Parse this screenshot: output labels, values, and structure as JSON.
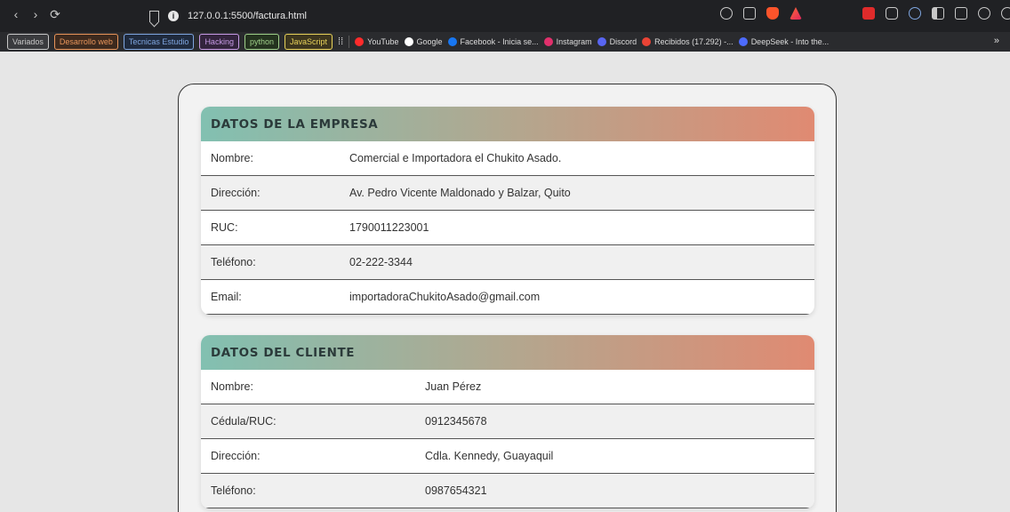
{
  "browser": {
    "url": "127.0.0.1:5500/factura.html",
    "bookmark_chips": [
      {
        "label": "Variados",
        "color": "#c8c8c8",
        "bg": "#3a3b3e"
      },
      {
        "label": "Desarrollo web",
        "color": "#e8955a",
        "bg": "#3d2a1e"
      },
      {
        "label": "Tecnicas Estudio",
        "color": "#7fa6e0",
        "bg": "#1f2a3d"
      },
      {
        "label": "Hacking",
        "color": "#c79be6",
        "bg": "#33243d"
      },
      {
        "label": "python",
        "color": "#9fd08a",
        "bg": "#24331f"
      },
      {
        "label": "JavaScript",
        "color": "#e8d25a",
        "bg": "#3d361e"
      }
    ],
    "bookmarks": [
      {
        "label": "YouTube",
        "icon": "youtube-icon",
        "color": "#ff2b2b"
      },
      {
        "label": "Google",
        "icon": "google-icon",
        "color": "#ffffff"
      },
      {
        "label": "Facebook - Inicia se...",
        "icon": "facebook-icon",
        "color": "#1877f2"
      },
      {
        "label": "Instagram",
        "icon": "instagram-icon",
        "color": "#e1306c"
      },
      {
        "label": "Discord",
        "icon": "discord-icon",
        "color": "#5865f2"
      },
      {
        "label": "Recibidos (17.292) -...",
        "icon": "gmail-icon",
        "color": "#ea4335"
      },
      {
        "label": "DeepSeek - Into the...",
        "icon": "deepseek-icon",
        "color": "#4d6bfe"
      }
    ],
    "more": "»"
  },
  "empresa": {
    "title": "DATOS DE LA EMPRESA",
    "rows": [
      {
        "label": "Nombre:",
        "value": "Comercial e Importadora el Chukito Asado."
      },
      {
        "label": "Dirección:",
        "value": "Av. Pedro Vicente Maldonado y Balzar, Quito"
      },
      {
        "label": "RUC:",
        "value": "1790011223001"
      },
      {
        "label": "Teléfono:",
        "value": "02-222-3344"
      },
      {
        "label": "Email:",
        "value": "importadoraChukitoAsado@gmail.com"
      }
    ]
  },
  "cliente": {
    "title": "DATOS DEL CLIENTE",
    "rows": [
      {
        "label": "Nombre:",
        "value": "Juan Pérez"
      },
      {
        "label": "Cédula/RUC:",
        "value": "0912345678"
      },
      {
        "label": "Dirección:",
        "value": "Cdla. Kennedy, Guayaquil"
      },
      {
        "label": "Teléfono:",
        "value": "0987654321"
      }
    ]
  }
}
